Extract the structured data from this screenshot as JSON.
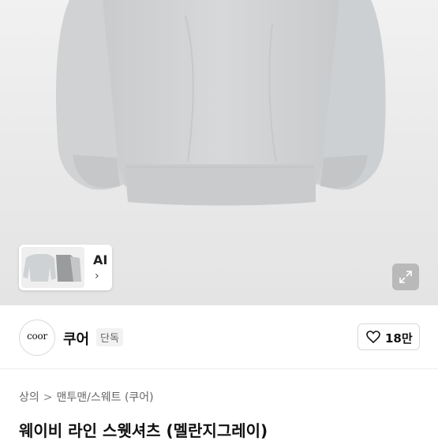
{
  "product_image": {
    "alt": "sweatshirt product photo",
    "background_color": "#e9e9e9",
    "garment_color": "#cfd1d3"
  },
  "thumbnail": {
    "label": "AI",
    "arrow": "›"
  },
  "expand_icon": "expand-arrows-icon",
  "seller": {
    "logo_text": "coor",
    "name": "쿠어",
    "badge": "단독"
  },
  "like": {
    "icon": "heart-outline-icon",
    "count": "18만"
  },
  "breadcrumb": {
    "level1": "상의",
    "separator": ">",
    "level2": "맨투맨/스웨트 (쿠어)"
  },
  "product_title": "웨이비 라인 스웻셔츠 (멜란지그레이)"
}
